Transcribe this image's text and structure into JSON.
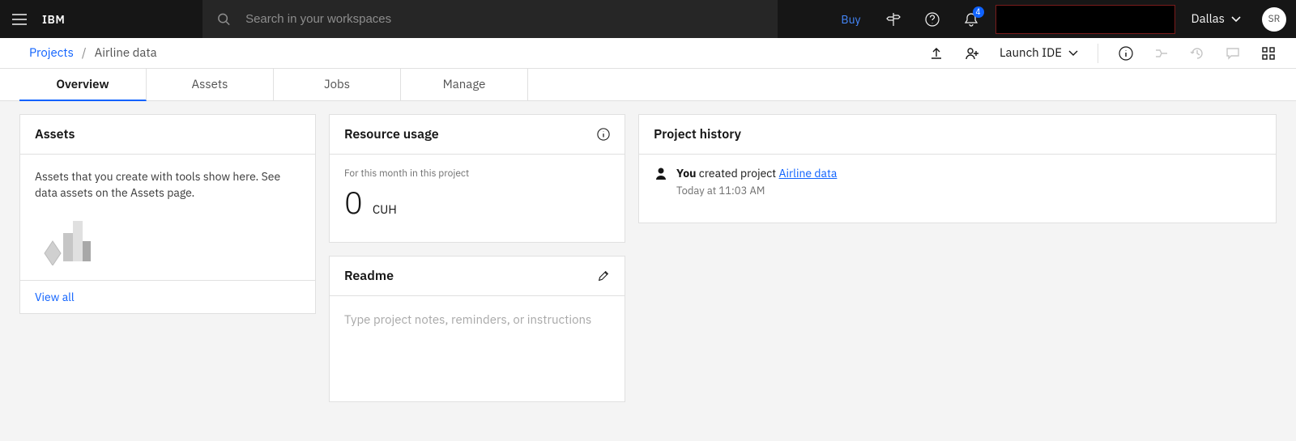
{
  "topbar": {
    "brand": "IBM",
    "search_placeholder": "Search in your workspaces",
    "buy_label": "Buy",
    "notification_count": "4",
    "region_label": "Dallas",
    "avatar_initials": "SR"
  },
  "breadcrumbs": {
    "root_label": "Projects",
    "current_label": "Airline data",
    "launch_ide_label": "Launch IDE"
  },
  "tabs": {
    "items": [
      {
        "label": "Overview",
        "active": true
      },
      {
        "label": "Assets",
        "active": false
      },
      {
        "label": "Jobs",
        "active": false
      },
      {
        "label": "Manage",
        "active": false
      }
    ]
  },
  "assets_card": {
    "title": "Assets",
    "description": "Assets that you create with tools show here. See data assets on the Assets page.",
    "view_all": "View all"
  },
  "resource_card": {
    "title": "Resource usage",
    "period_label": "For this month in this project",
    "value": "0",
    "unit": "CUH"
  },
  "readme_card": {
    "title": "Readme",
    "placeholder": "Type project notes, reminders, or instructions"
  },
  "history_card": {
    "title": "Project history",
    "entry_actor": "You",
    "entry_action": " created project ",
    "entry_link": "Airline data",
    "entry_time": "Today at 11:03 AM"
  }
}
